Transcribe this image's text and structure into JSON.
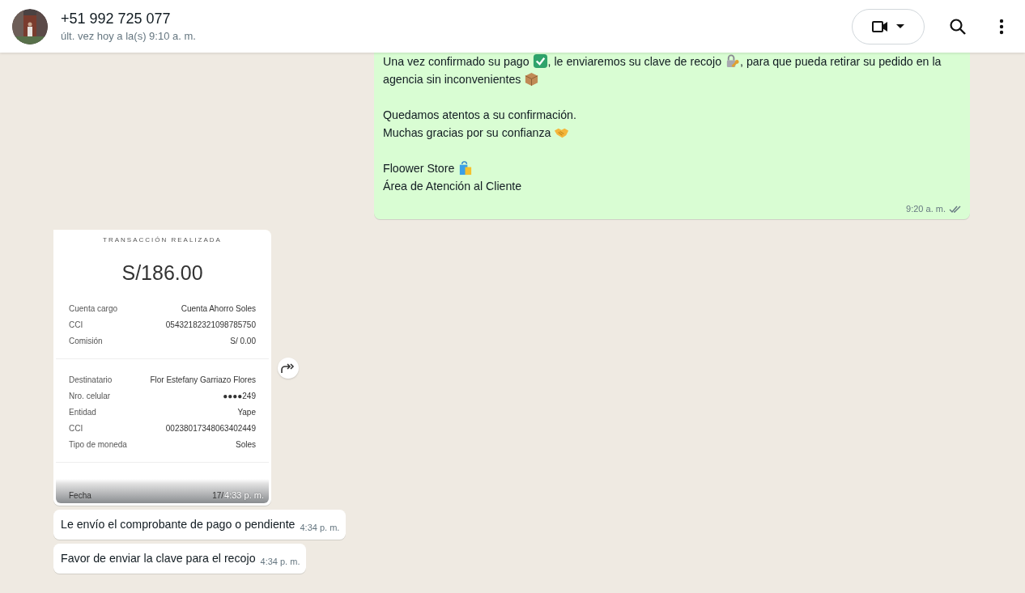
{
  "header": {
    "title": "+51 992 725 077",
    "status": "últ. vez hoy a la(s) 9:10 a. m."
  },
  "messages": [
    {
      "kind": "text",
      "outgoing": true,
      "delivered": true,
      "time": "9:20 a. m.",
      "blocks": [
        [
          [
            {
              "text": "Una vez confirmado su pago "
            },
            {
              "kind": "emoji"
            },
            {
              "text": ", le enviaremos su clave de recojo "
            },
            {
              "kind": "emoji"
            },
            {
              "text": ", para que pueda retirar su pedido en la agencia sin inconvenientes "
            },
            {
              "kind": "emoji"
            }
          ]
        ],
        [
          [
            {
              "text": "Quedamos atentos a su confirmación."
            }
          ],
          [
            {
              "text": "Muchas gracias por su confianza "
            },
            {
              "kind": "emoji"
            }
          ]
        ],
        [
          [
            {
              "text": "Floower Store "
            },
            {
              "kind": "emoji"
            }
          ],
          [
            {
              "text": "Área de Atención al Cliente"
            }
          ]
        ]
      ]
    },
    {
      "kind": "receipt",
      "outgoing": false,
      "time": "4:33 p. m.",
      "receipt": {
        "heading": "TRANSACCIÓN REALIZADA",
        "amount": "S/186.00",
        "sections": [
          [
            {
              "label": "Cuenta cargo",
              "value": "Cuenta Ahorro Soles"
            },
            {
              "label": "CCI",
              "value": "05432182321098785750"
            },
            {
              "label": "Comisión",
              "value": "S/ 0.00"
            }
          ],
          [
            {
              "label": "Destinatario",
              "value": "Flor Estefany Garriazo Flores"
            },
            {
              "label": "Nro. celular",
              "value": "●●●●249"
            },
            {
              "label": "Entidad",
              "value": "Yape"
            },
            {
              "label": "CCI",
              "value": "00238017348063402449"
            },
            {
              "label": "Tipo de moneda",
              "value": "Soles"
            }
          ],
          [
            {
              "label": "Fecha",
              "value": "17/"
            }
          ]
        ]
      }
    },
    {
      "kind": "text",
      "outgoing": false,
      "time": "4:34 p. m.",
      "blocks": [
        [
          [
            {
              "text": "Le envío el comprobante de pago o pendiente"
            }
          ]
        ]
      ]
    },
    {
      "kind": "text",
      "outgoing": false,
      "time": "4:34 p. m.",
      "blocks": [
        [
          [
            {
              "text": "Favor de enviar la clave para el recojo"
            }
          ]
        ]
      ]
    }
  ]
}
